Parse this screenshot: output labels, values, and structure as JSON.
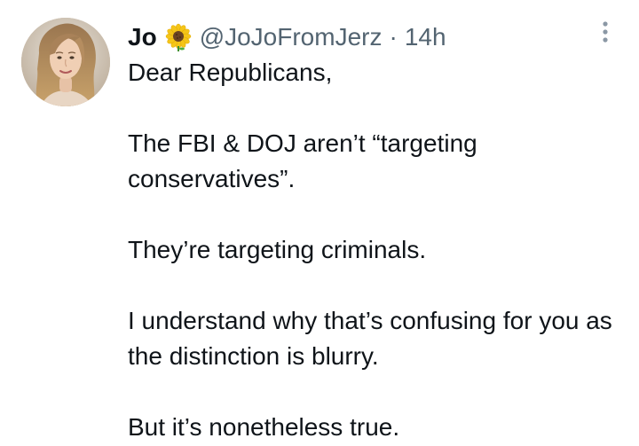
{
  "tweet": {
    "author_name": "Jo",
    "name_emoji_icon": "sunflower-icon",
    "handle": "@JoJoFromJerz",
    "separator": "·",
    "time": "14h",
    "more_icon": "more-vertical-icon",
    "paragraphs": [
      "Dear Republicans,",
      "The FBI & DOJ aren’t “targeting conservatives”.",
      "They’re targeting criminals.",
      "I understand why that’s confusing for you as the distinction is blurry.",
      "But it’s nonetheless true."
    ]
  },
  "colors": {
    "text_primary": "#0f1419",
    "text_secondary": "#536471",
    "background": "#ffffff"
  }
}
